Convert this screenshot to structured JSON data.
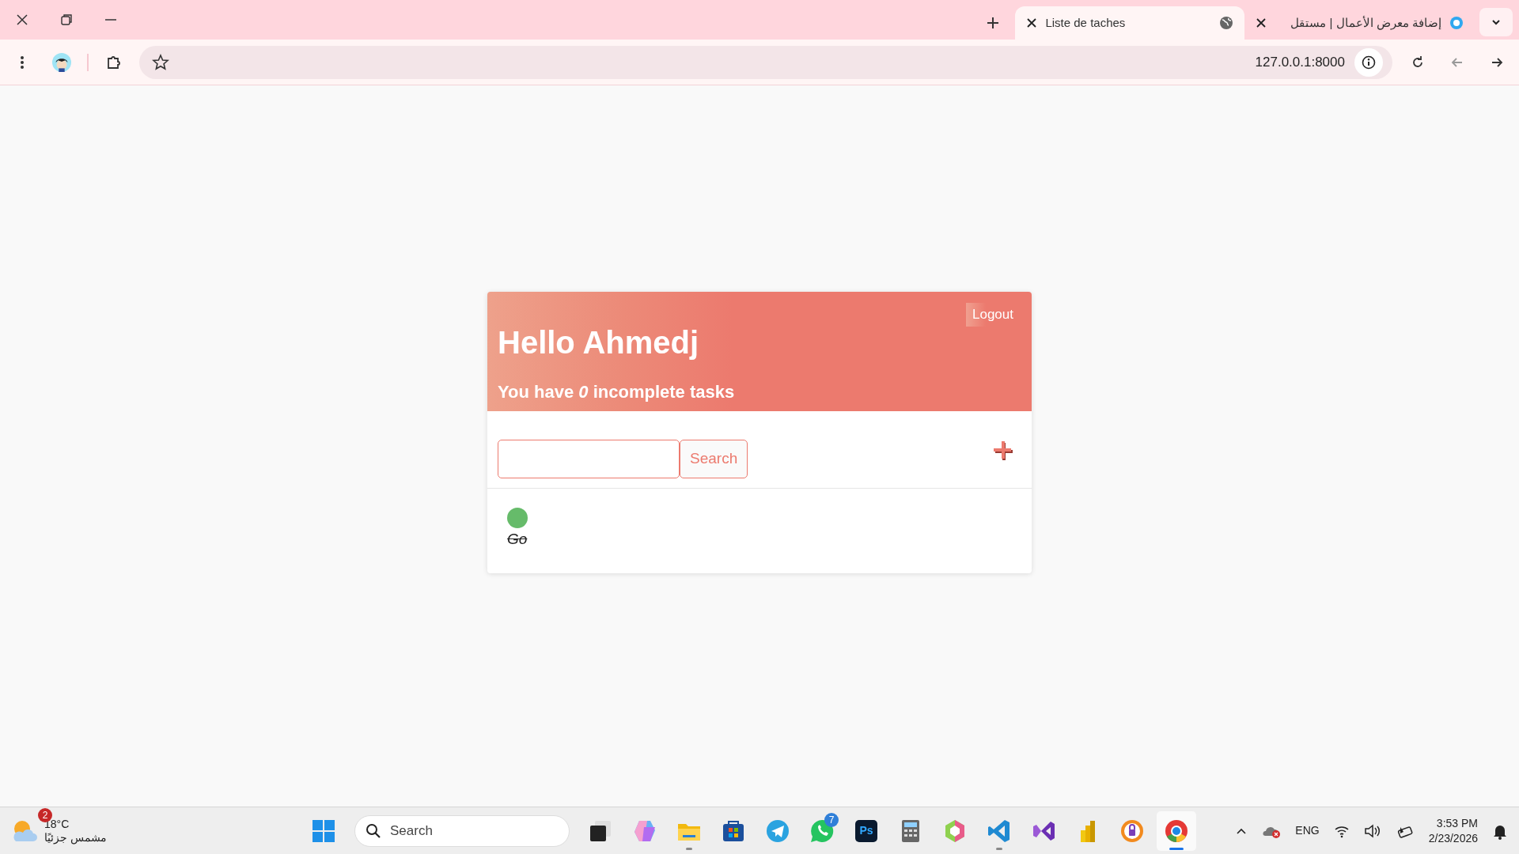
{
  "browser": {
    "tabs": [
      {
        "title": "Liste de taches",
        "selected": true,
        "kind": "globe"
      },
      {
        "title": "إضافة معرض الأعمال | مستقل",
        "selected": false,
        "kind": "ring"
      }
    ],
    "address": "127.0.0.1:8000"
  },
  "page": {
    "greeting": "Hello Ahmedj",
    "summary": "You have *0* incomplete tasks",
    "logout": "Logout",
    "search_button": "Search",
    "tasks": [
      {
        "title": "Go",
        "completed": true
      }
    ]
  },
  "taskbar": {
    "weather": {
      "temperature": "18°C",
      "condition": "مشمس جزئيًا",
      "badge": "2"
    },
    "search": {
      "placeholder": "Search"
    },
    "apps": [
      {
        "kind": "start",
        "running": false,
        "selected": false
      },
      {
        "kind": "search"
      },
      {
        "kind": "taskview",
        "running": false,
        "selected": false
      },
      {
        "kind": "copilot",
        "running": false,
        "selected": false
      },
      {
        "kind": "folder",
        "running": true,
        "selected": false
      },
      {
        "kind": "store",
        "running": false,
        "selected": false
      },
      {
        "kind": "telegram",
        "running": false,
        "selected": false
      },
      {
        "kind": "whatsapp",
        "running": false,
        "selected": false,
        "badge": "7"
      },
      {
        "kind": "photoshop",
        "running": false,
        "selected": false,
        "label": "Ps"
      },
      {
        "kind": "calculator",
        "running": false,
        "selected": false
      },
      {
        "kind": "cube",
        "running": false,
        "selected": false
      },
      {
        "kind": "vscode",
        "running": true,
        "selected": false
      },
      {
        "kind": "studio",
        "running": false,
        "selected": false
      },
      {
        "kind": "powerbi",
        "running": false,
        "selected": false
      },
      {
        "kind": "lock",
        "running": false,
        "selected": false
      },
      {
        "kind": "chrome",
        "running": true,
        "selected": true
      }
    ],
    "language": "ENG",
    "time": "3:53 PM",
    "date": "2/23/2026"
  }
}
